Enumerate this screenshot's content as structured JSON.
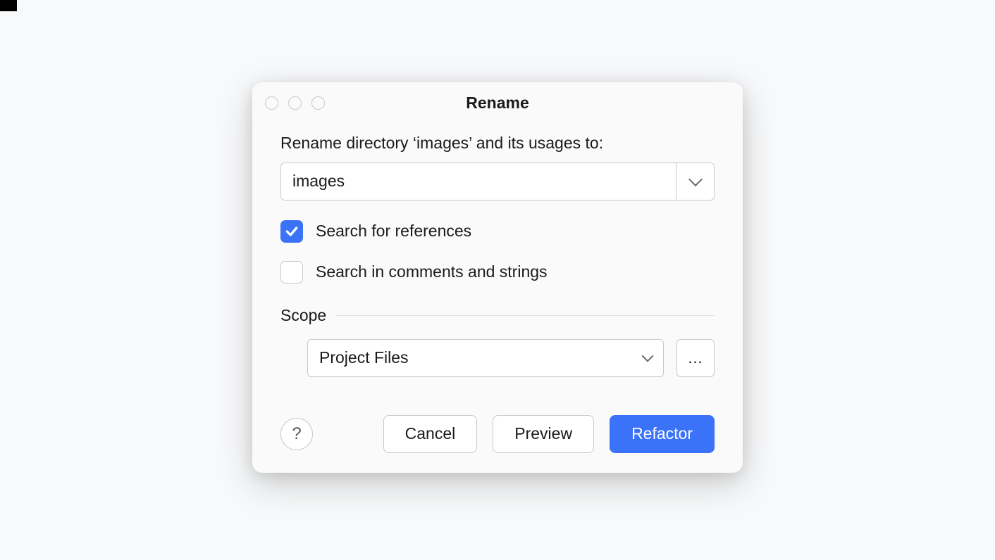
{
  "dialog": {
    "title": "Rename",
    "prompt": "Rename directory ‘images’ and its usages to:",
    "name_input_value": "images",
    "checkbox_refs": {
      "checked": true,
      "label": "Search for references"
    },
    "checkbox_comments": {
      "checked": false,
      "label": "Search in comments and strings"
    },
    "scope": {
      "label": "Scope",
      "selected": "Project Files",
      "extra_button": "..."
    },
    "buttons": {
      "help": "?",
      "cancel": "Cancel",
      "preview": "Preview",
      "refactor": "Refactor"
    }
  }
}
